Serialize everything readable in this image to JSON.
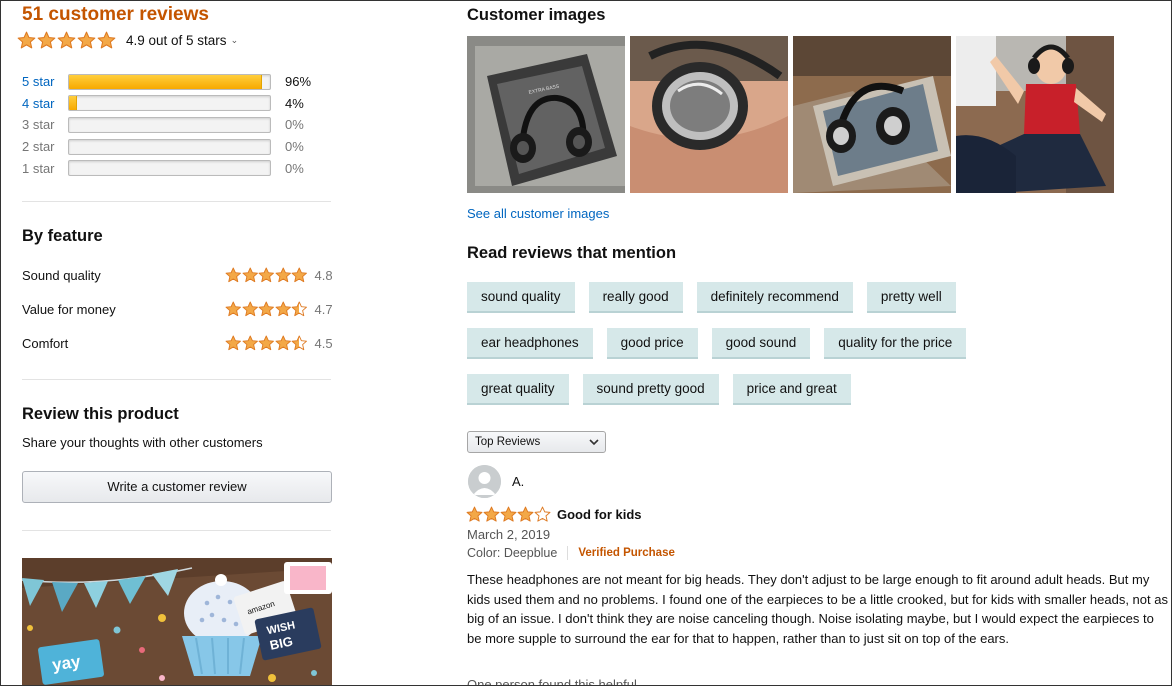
{
  "summary": {
    "title": "51 customer reviews",
    "rating_text": "4.9 out of 5 stars",
    "star_fill": [
      1,
      1,
      1,
      1,
      1
    ]
  },
  "histogram": [
    {
      "label": "5 star",
      "percent_text": "96%",
      "percent": 96,
      "is_link": true
    },
    {
      "label": "4 star",
      "percent_text": "4%",
      "percent": 4,
      "is_link": true
    },
    {
      "label": "3 star",
      "percent_text": "0%",
      "percent": 0,
      "is_link": false
    },
    {
      "label": "2 star",
      "percent_text": "0%",
      "percent": 0,
      "is_link": false
    },
    {
      "label": "1 star",
      "percent_text": "0%",
      "percent": 0,
      "is_link": false
    }
  ],
  "by_feature": {
    "title": "By feature",
    "items": [
      {
        "name": "Sound quality",
        "value": "4.8",
        "rating": 4.8
      },
      {
        "name": "Value for money",
        "value": "4.7",
        "rating": 4.7
      },
      {
        "name": "Comfort",
        "value": "4.5",
        "rating": 4.5
      }
    ]
  },
  "review_product": {
    "title": "Review this product",
    "subtitle": "Share your thoughts with other customers",
    "button_label": "Write a customer review"
  },
  "promo_banner": {
    "brand": "amazon",
    "wish": "WISH",
    "big": "BIG",
    "yay": "yay"
  },
  "customer_images": {
    "title": "Customer images",
    "see_all": "See all customer images",
    "thumb_box_text": "EXTRA BASS"
  },
  "mentions": {
    "title": "Read reviews that mention",
    "rows": [
      [
        "sound quality",
        "really good",
        "definitely recommend",
        "pretty well"
      ],
      [
        "ear headphones",
        "good price",
        "good sound",
        "quality for the price"
      ],
      [
        "great quality",
        "sound pretty good",
        "price and great"
      ]
    ]
  },
  "sort": {
    "selected": "Top Reviews"
  },
  "review": {
    "author": "A.",
    "rating": 4,
    "title": "Good for kids",
    "date": "March 2, 2019",
    "color": "Color: Deepblue",
    "verified": "Verified Purchase",
    "body": "These headphones are not meant for big heads. They don't adjust to be large enough to fit around adult heads. But my kids used them and no problems. I found one of the earpieces to be a little crooked, but for kids with smaller heads, not as big of an issue. I don't think they are noise canceling though. Noise isolating maybe, but I would expect the earpieces to be more supple to surround the ear for that to happen, rather than to just sit on top of the ears.",
    "helpful_partial": "One person found this helpful"
  },
  "colors": {
    "star": "#f3a847",
    "link": "#0066c0",
    "accent": "#c45500",
    "chip_bg": "#d6e8e9"
  }
}
